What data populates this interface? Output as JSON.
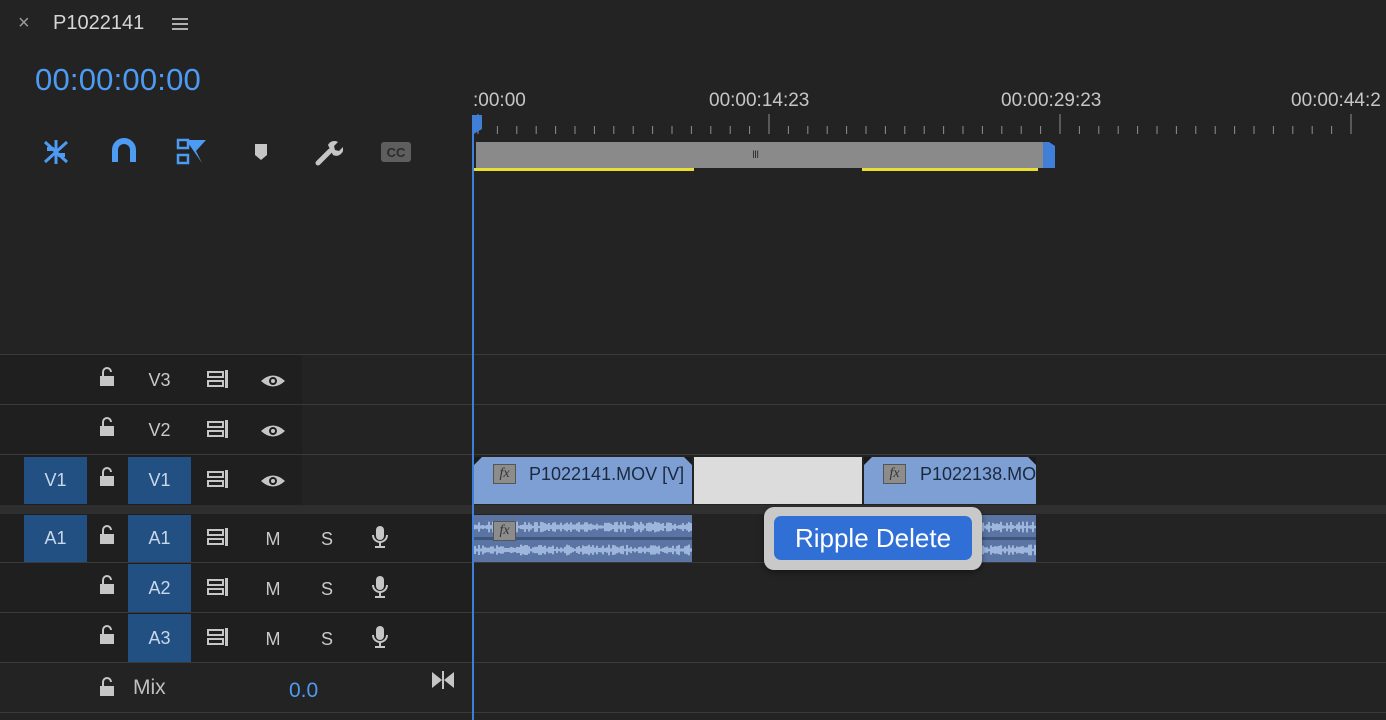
{
  "window": {
    "close_glyph": "×",
    "title": "P1022141",
    "timecode": "00:00:00:00"
  },
  "toolbar": [
    {
      "name": "insert-overwrite-sequences-icon"
    },
    {
      "name": "snap-magnet-icon"
    },
    {
      "name": "linked-selection-icon"
    },
    {
      "name": "add-marker-icon"
    },
    {
      "name": "timeline-settings-wrench-icon"
    },
    {
      "name": "closed-captions-icon",
      "label": "CC"
    }
  ],
  "ruler": {
    "labels": [
      ":00:00",
      "00:00:14:23",
      "00:00:29:23",
      "00:00:44:2"
    ],
    "work_area_handle": "III"
  },
  "tracks": {
    "video": [
      {
        "source": "",
        "target": "V3",
        "targeted": false
      },
      {
        "source": "",
        "target": "V2",
        "targeted": false
      },
      {
        "source": "V1",
        "target": "V1",
        "targeted": true
      }
    ],
    "audio": [
      {
        "source": "A1",
        "target": "A1",
        "targeted": true,
        "mute": "M",
        "solo": "S"
      },
      {
        "source": "",
        "target": "A2",
        "targeted": true,
        "mute": "M",
        "solo": "S"
      },
      {
        "source": "",
        "target": "A3",
        "targeted": true,
        "mute": "M",
        "solo": "S"
      }
    ],
    "mix": {
      "label": "Mix",
      "value": "0.0"
    }
  },
  "clips": {
    "video": [
      {
        "name": "P1022141.MOV [V]",
        "fx": "fx"
      },
      {
        "name": "P1022138.MO",
        "fx": "fx"
      }
    ],
    "audio": [
      {
        "fx": "fx"
      }
    ]
  },
  "context_popup": {
    "ripple_delete_label": "Ripple Delete"
  },
  "colors": {
    "accent": "#4d9bf2",
    "clip_video": "#7d9fd3",
    "clip_audio": "#5a75a3",
    "work_area_rendered": "#e9de33",
    "track_target": "#225083"
  }
}
